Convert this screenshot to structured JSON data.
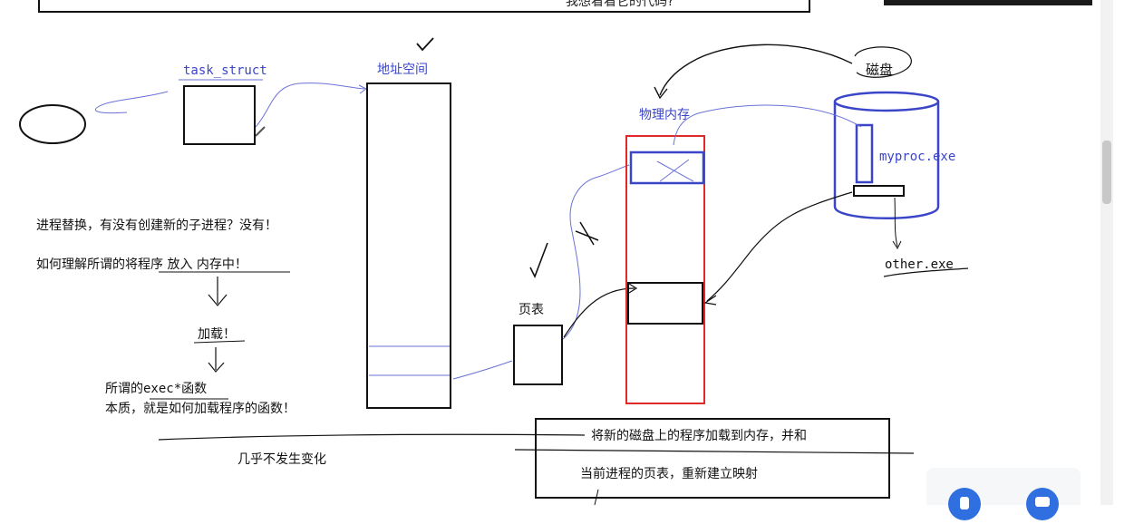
{
  "top_note": "我想看看它的代码?",
  "labels": {
    "task_struct": "task_struct",
    "address_space": "地址空间",
    "physical_memory": "物理内存",
    "disk": "磁盘",
    "myproc": "myproc.exe",
    "other": "other.exe",
    "page_table": "页表"
  },
  "notes": {
    "line1": "进程替换，有没有创建新的子进程？没有！",
    "line2": "如何理解所谓的将程序 放入 内存中！",
    "load": "加载！",
    "exec_prefix": "所谓的",
    "exec_name": "exec*",
    "exec_suffix": "函数",
    "essence": "本质，就是如何加载程序的函数！",
    "unchanged": "几乎不发生变化"
  },
  "bottom_box": {
    "line1": "将新的磁盘上的程序加载到内存，并和",
    "line2": "当前进程的页表，重新建立映射"
  },
  "colors": {
    "ink": "#111111",
    "pen_blue": "#3a45c8",
    "pen_red": "#e02a2a",
    "accent_btn": "#2f6fe0"
  }
}
